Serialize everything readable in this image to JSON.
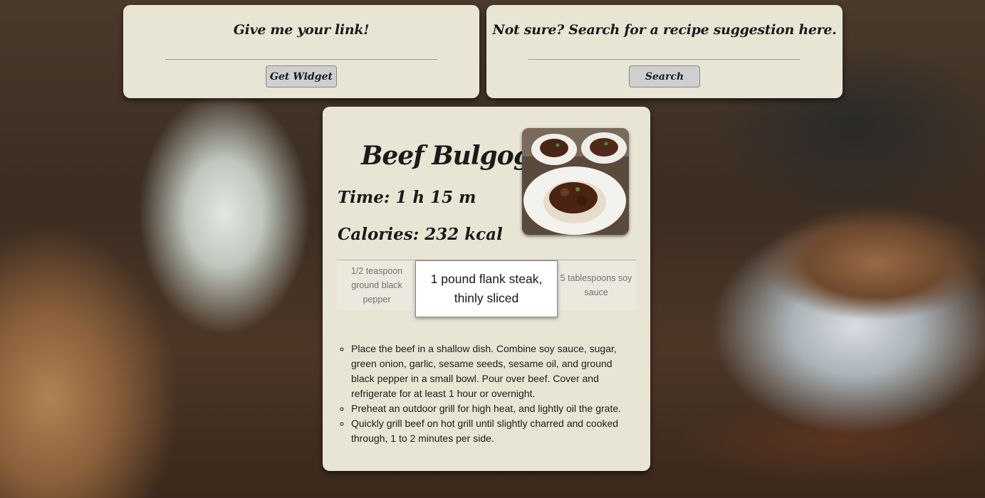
{
  "link_panel": {
    "prompt": "Give me your link!",
    "url_value": "",
    "button_label": "Get Widget"
  },
  "search_panel": {
    "prompt": "Not sure? Search for a recipe suggestion here.",
    "query_value": "",
    "button_label": "Search"
  },
  "recipe": {
    "title": "Beef Bulgogi",
    "time": "Time: 1 h 15 m",
    "calories": "Calories: 232 kcal",
    "photo_icon": "food-photo",
    "ingredients": [
      "1/2 teaspoon ground black pepper",
      "1 pound flank steak, thinly sliced",
      "5 tablespoons soy sauce"
    ],
    "directions": [
      "Place the beef in a shallow dish. Combine soy sauce, sugar, green onion, garlic, sesame seeds, sesame oil, and ground black pepper in a small bowl. Pour over beef. Cover and refrigerate for at least 1 hour or overnight.",
      "Preheat an outdoor grill for high heat, and lightly oil the grate.",
      "Quickly grill beef on hot grill until slightly charred and cooked through, 1 to 2 minutes per side."
    ]
  }
}
